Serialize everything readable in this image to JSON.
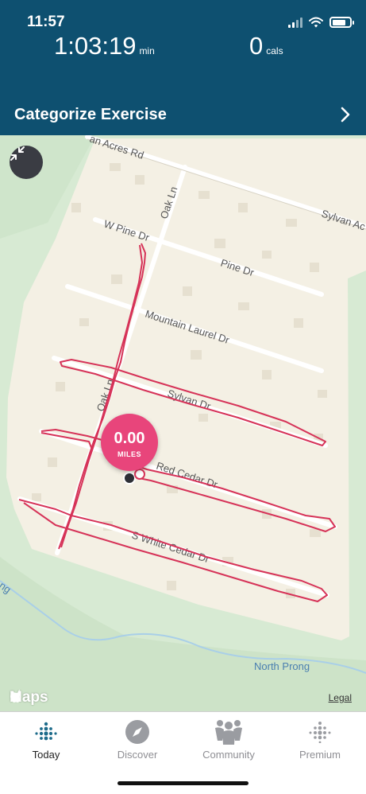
{
  "status_bar": {
    "time": "11:57"
  },
  "summary": {
    "duration_value": "1:03:19",
    "duration_unit": "min",
    "calories_value": "0",
    "calories_unit": "cals"
  },
  "categorize": {
    "label": "Categorize Exercise"
  },
  "map": {
    "streets": {
      "acres": "an Acres Rd",
      "sylvan_ac": "Sylvan Ac",
      "oak_top": "Oak Ln",
      "w_pine": "W Pine Dr",
      "pine": "Pine Dr",
      "mountain_laurel": "Mountain Laurel Dr",
      "oak_bottom": "Oak Ln",
      "sylvan": "Sylvan Dr",
      "red_cedar": "Red Cedar Dr",
      "white_cedar": "S White Cedar Dr",
      "north_prong": "North Prong",
      "creek_left": "ng"
    },
    "distance_value": "0.00",
    "distance_unit": "MILES",
    "attribution": "Maps",
    "legal": "Legal",
    "route_color": "#d63358"
  },
  "tabs": [
    {
      "label": "Today",
      "icon": "today-dots-icon",
      "active": true
    },
    {
      "label": "Discover",
      "icon": "compass-icon",
      "active": false
    },
    {
      "label": "Community",
      "icon": "community-icon",
      "active": false
    },
    {
      "label": "Premium",
      "icon": "premium-dots-icon",
      "active": false
    }
  ],
  "colors": {
    "header": "#0e5070",
    "accent": "#e8457b"
  }
}
